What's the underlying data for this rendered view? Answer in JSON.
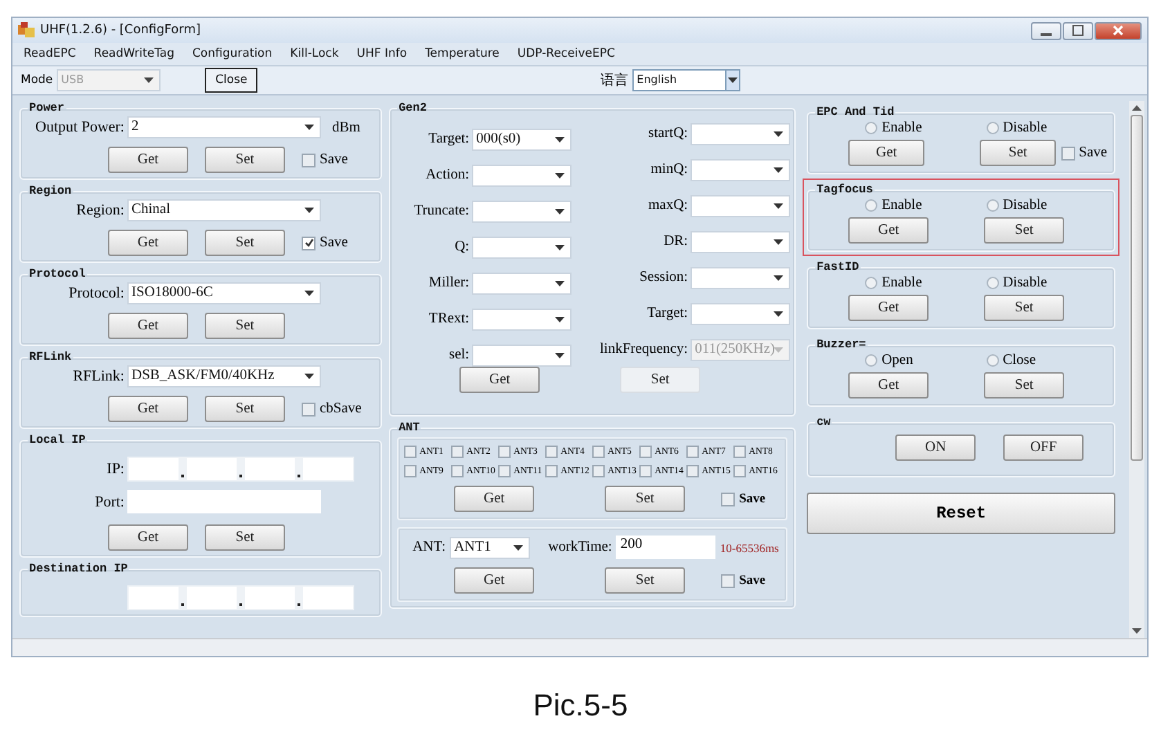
{
  "window": {
    "title": "UHF(1.2.6) - [ConfigForm]"
  },
  "menu": [
    "ReadEPC",
    "ReadWriteTag",
    "Configuration",
    "Kill-Lock",
    "UHF Info",
    "Temperature",
    "UDP-ReceiveEPC"
  ],
  "toolbar": {
    "mode_label": "Mode",
    "mode_value": "USB",
    "mode_disabled": true,
    "close_button": "Close",
    "language_label": "语言",
    "language_value": "English"
  },
  "left_groups": [
    {
      "kind": "combo",
      "title": "Power",
      "label": "Output Power:",
      "value": "2",
      "unit": "dBm",
      "buttons": [
        "Get",
        "Set"
      ],
      "save": {
        "label": "Save",
        "checked": false
      }
    },
    {
      "kind": "combo",
      "title": "Region",
      "label": "Region:",
      "value": "Chinal",
      "buttons": [
        "Get",
        "Set"
      ],
      "save": {
        "label": "Save",
        "checked": true
      }
    },
    {
      "kind": "combo",
      "title": "Protocol",
      "label": "Protocol:",
      "value": "ISO18000-6C",
      "buttons": [
        "Get",
        "Set"
      ]
    },
    {
      "kind": "combo",
      "title": "RFLink",
      "label": "RFLink:",
      "value": "DSB_ASK/FM0/40KHz",
      "buttons": [
        "Get",
        "Set"
      ],
      "save": {
        "label": "cbSave",
        "checked": false
      }
    },
    {
      "kind": "ip",
      "title": "Local IP",
      "ip_label": "IP:",
      "port_label": "Port:",
      "buttons": [
        "Get",
        "Set"
      ]
    },
    {
      "kind": "ip",
      "title": "Destination IP"
    }
  ],
  "gen2": {
    "title": "Gen2",
    "left": [
      {
        "label": "Target:",
        "value": "000(s0)"
      },
      {
        "label": "Action:"
      },
      {
        "label": "Truncate:"
      },
      {
        "label": "Q:"
      },
      {
        "label": "Miller:"
      },
      {
        "label": "TRext:"
      },
      {
        "label": "sel:"
      }
    ],
    "right": [
      {
        "label": "startQ:",
        "disabled": false
      },
      {
        "label": "minQ:",
        "disabled": false
      },
      {
        "label": "maxQ:",
        "disabled": false
      },
      {
        "label": "DR:",
        "disabled": false
      },
      {
        "label": "Session:",
        "disabled": false
      },
      {
        "label": "Target:",
        "disabled": false
      },
      {
        "label": "linkFrequency:",
        "value": "011(250KHz)",
        "disabled": true
      }
    ],
    "buttons": [
      {
        "label": "Get",
        "disabled": false
      },
      {
        "label": "Set",
        "disabled": true
      }
    ]
  },
  "ant": {
    "title": "ANT",
    "antennas": [
      {
        "label": "ANT1",
        "checked": false
      },
      {
        "label": "ANT2",
        "checked": false
      },
      {
        "label": "ANT3",
        "checked": false
      },
      {
        "label": "ANT4",
        "checked": false
      },
      {
        "label": "ANT5",
        "checked": false
      },
      {
        "label": "ANT6",
        "checked": false
      },
      {
        "label": "ANT7",
        "checked": false
      },
      {
        "label": "ANT8",
        "checked": false
      },
      {
        "label": "ANT9",
        "checked": false
      },
      {
        "label": "ANT10",
        "checked": false
      },
      {
        "label": "ANT11",
        "checked": false
      },
      {
        "label": "ANT12",
        "checked": false
      },
      {
        "label": "ANT13",
        "checked": false
      },
      {
        "label": "ANT14",
        "checked": false
      },
      {
        "label": "ANT15",
        "checked": false
      },
      {
        "label": "ANT16",
        "checked": false
      }
    ],
    "buttons": [
      "Get",
      "Set"
    ],
    "save": {
      "label": "Save",
      "checked": false
    },
    "work": {
      "ant_label": "ANT:",
      "ant_value": "ANT1",
      "time_label": "workTime:",
      "time_value": "200",
      "hint": "10-65536ms",
      "buttons": [
        "Get",
        "Set"
      ],
      "save": {
        "label": "Save",
        "checked": false
      }
    }
  },
  "right_groups": [
    {
      "kind": "radio",
      "title": "EPC And Tid",
      "highlighted": false,
      "options": [
        {
          "label": "Enable",
          "selected": false
        },
        {
          "label": "Disable",
          "selected": false
        }
      ],
      "buttons": [
        "Get",
        "Set"
      ],
      "save": {
        "label": "Save",
        "checked": false
      }
    },
    {
      "kind": "radio",
      "title": "Tagfocus",
      "highlighted": true,
      "options": [
        {
          "label": "Enable",
          "selected": false
        },
        {
          "label": "Disable",
          "selected": false
        }
      ],
      "buttons": [
        "Get",
        "Set"
      ]
    },
    {
      "kind": "radio",
      "title": "FastID",
      "highlighted": false,
      "options": [
        {
          "label": "Enable",
          "selected": false
        },
        {
          "label": "Disable",
          "selected": false
        }
      ],
      "buttons": [
        "Get",
        "Set"
      ]
    },
    {
      "kind": "radio",
      "title": "Buzzer=",
      "highlighted": false,
      "options": [
        {
          "label": "Open",
          "selected": false
        },
        {
          "label": "Close",
          "selected": false
        }
      ],
      "buttons": [
        "Get",
        "Set"
      ]
    },
    {
      "kind": "buttons",
      "title": "cw",
      "highlighted": false,
      "buttons": [
        "ON",
        "OFF"
      ]
    }
  ],
  "reset_button": "Reset",
  "caption": "Pic.5-5"
}
